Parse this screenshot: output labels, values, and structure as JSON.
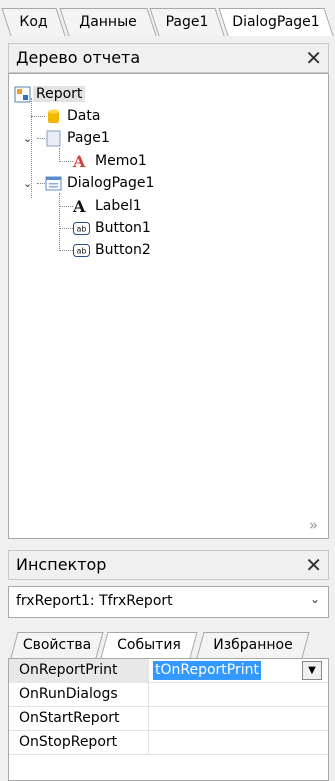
{
  "tabs": [
    "Код",
    "Данные",
    "Page1",
    "DialogPage1"
  ],
  "report_tree": {
    "title": "Дерево отчета",
    "nodes": {
      "report": "Report",
      "data": "Data",
      "page1": "Page1",
      "memo1": "Memo1",
      "dialogpage1": "DialogPage1",
      "label1": "Label1",
      "button1": "Button1",
      "button2": "Button2"
    },
    "more_glyph": "»"
  },
  "inspector": {
    "title": "Инспектор",
    "object_select": "frxReport1: TfrxReport",
    "tabs": [
      "Свойства",
      "События",
      "Избранное"
    ],
    "rows": [
      {
        "name": "OnReportPrint",
        "value": "tOnReportPrint"
      },
      {
        "name": "OnRunDialogs",
        "value": ""
      },
      {
        "name": "OnStartReport",
        "value": ""
      },
      {
        "name": "OnStopReport",
        "value": ""
      }
    ]
  },
  "colors": {
    "selection": "#3399ff",
    "panel": "#f0f0f0",
    "border": "#a8a8a8"
  }
}
